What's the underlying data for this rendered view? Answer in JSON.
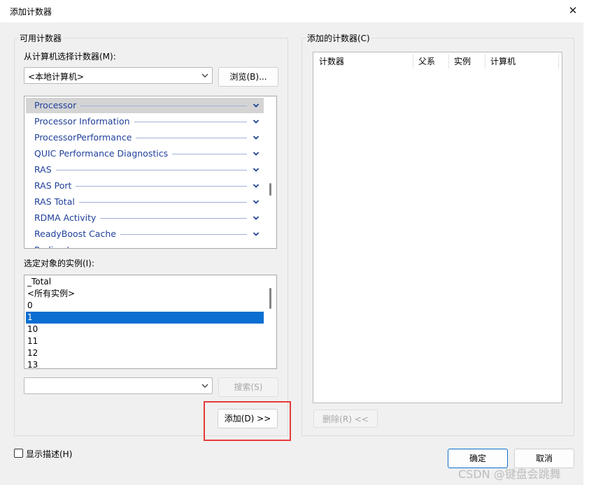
{
  "window": {
    "title": "添加计数器",
    "close_glyph": "✕"
  },
  "available": {
    "group_label": "可用计数器",
    "select_from_label": "从计算机选择计数器(M):",
    "computer_value": "<本地计算机>",
    "browse_button": "浏览(B)...",
    "objects": [
      {
        "name": "Processor",
        "selected": true
      },
      {
        "name": "Processor Information",
        "selected": false
      },
      {
        "name": "ProcessorPerformance",
        "selected": false
      },
      {
        "name": "QUIC Performance Diagnostics",
        "selected": false
      },
      {
        "name": "RAS",
        "selected": false
      },
      {
        "name": "RAS Port",
        "selected": false
      },
      {
        "name": "RAS Total",
        "selected": false
      },
      {
        "name": "RDMA Activity",
        "selected": false
      },
      {
        "name": "ReadyBoost Cache",
        "selected": false
      },
      {
        "name": "Redirector",
        "selected": false
      }
    ],
    "instances_label": "选定对象的实例(I):",
    "instances": [
      {
        "name": "_Total",
        "selected": false
      },
      {
        "name": "<所有实例>",
        "selected": false
      },
      {
        "name": "0",
        "selected": false
      },
      {
        "name": "1",
        "selected": true
      },
      {
        "name": "10",
        "selected": false
      },
      {
        "name": "11",
        "selected": false
      },
      {
        "name": "12",
        "selected": false
      },
      {
        "name": "13",
        "selected": false
      }
    ],
    "search_value": "",
    "search_button": "搜索(S)",
    "add_button": "添加(D) >>"
  },
  "added": {
    "group_label": "添加的计数器(C)",
    "columns": [
      "计数器",
      "父系",
      "实例",
      "计算机"
    ],
    "remove_button": "删除(R) <<"
  },
  "footer": {
    "show_description_label": "显示描述(H)",
    "ok_button": "确定",
    "cancel_button": "取消"
  },
  "watermark": "CSDN @键盘会跳舞",
  "colors": {
    "selection": "#0a6fd1",
    "highlight_box": "#e63a3a",
    "object_text": "#1f3f9a"
  }
}
